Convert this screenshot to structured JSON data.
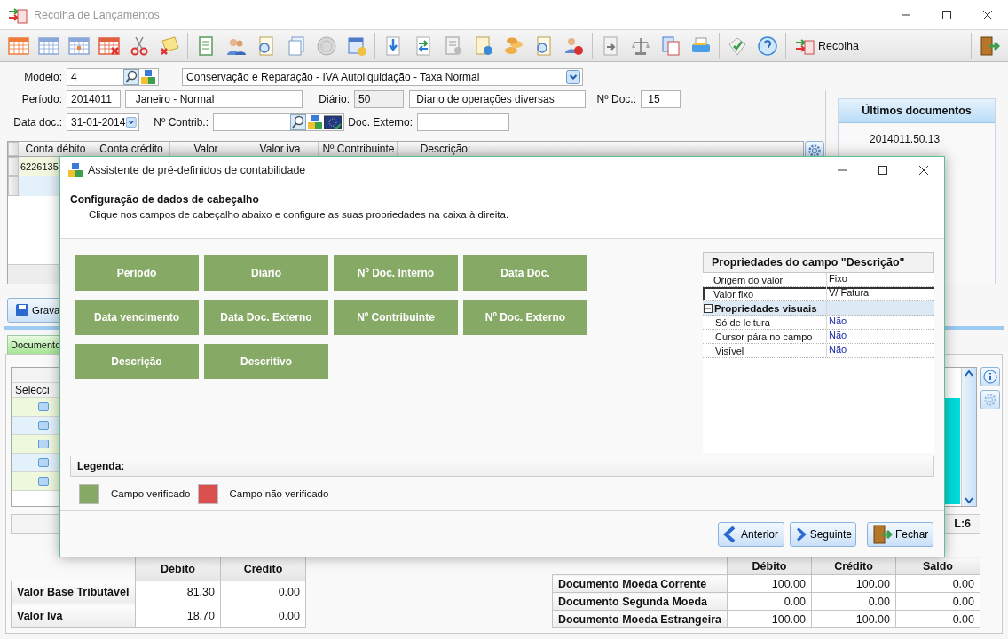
{
  "window": {
    "title": "Recolha de Lançamentos"
  },
  "toolbar": {
    "recolha_button": "Recolha"
  },
  "form": {
    "modelo": {
      "label": "Modelo:",
      "value": "4",
      "description": "Conservação e Reparação - IVA Autoliquidação - Taxa Normal"
    },
    "periodo": {
      "label": "Período:",
      "value": "2014011",
      "description": "Janeiro - Normal"
    },
    "diario": {
      "label": "Diário:",
      "value": "50",
      "description": "Diario de operações diversas"
    },
    "n_doc": {
      "label": "Nº Doc.:",
      "value": "15"
    },
    "data_doc": {
      "label": "Data doc.:",
      "value": "31-01-2014"
    },
    "n_contrib": {
      "label": "Nº Contrib.:"
    },
    "doc_externo": {
      "label": "Doc. Externo:"
    }
  },
  "entries_grid": {
    "columns": [
      "Conta débito",
      "Conta crédito",
      "Valor",
      "Valor iva",
      "Nº Contribuinte",
      "Descrição:"
    ],
    "rows": [
      [
        "6226135"
      ]
    ]
  },
  "last_documents": {
    "title": "Últimos documentos",
    "items": [
      "2014011.50.13"
    ]
  },
  "save_button": {
    "label": "Grava"
  },
  "tabs": [
    {
      "label": "Documento",
      "selected": true
    }
  ],
  "lines_grid": {
    "columns": [
      "Selecci"
    ]
  },
  "status": {
    "line_count": "L:6"
  },
  "totals": {
    "columns": [
      "Débito",
      "Crédito"
    ],
    "rows": [
      {
        "label": "Valor Base Tributável",
        "values": [
          "81.30",
          "0.00"
        ]
      },
      {
        "label": "Valor Iva",
        "values": [
          "18.70",
          "0.00"
        ]
      }
    ]
  },
  "currency_totals": {
    "columns": [
      "Débito",
      "Crédito",
      "Saldo"
    ],
    "rows": [
      {
        "label": "Documento Moeda Corrente",
        "values": [
          "100.00",
          "100.00",
          "0.00"
        ]
      },
      {
        "label": "Documento Segunda Moeda",
        "values": [
          "0.00",
          "0.00",
          "0.00"
        ]
      },
      {
        "label": "Documento Moeda Estrangeira",
        "values": [
          "100.00",
          "100.00",
          "0.00"
        ]
      }
    ]
  },
  "dialog": {
    "title": "Assistente de pré-definidos de contabilidade",
    "heading": "Configuração de dados de cabeçalho",
    "subtitle": "Clique nos campos de cabeçalho abaixo e configure as suas propriedades na caixa à direita.",
    "fields": [
      {
        "label": "Período",
        "verified": true
      },
      {
        "label": "Diário",
        "verified": true
      },
      {
        "label": "Nº Doc. Interno",
        "verified": true
      },
      {
        "label": "Data Doc.",
        "verified": true
      },
      {
        "label": "Data vencimento",
        "verified": true
      },
      {
        "label": "Data Doc. Externo",
        "verified": true
      },
      {
        "label": "Nº Contribuinte",
        "verified": true
      },
      {
        "label": "Nº Doc. Externo",
        "verified": true
      },
      {
        "label": "Descrição",
        "verified": true
      },
      {
        "label": "Descritivo",
        "verified": true
      }
    ],
    "properties": {
      "title": "Propriedades do campo \"Descrição\"",
      "rows": [
        {
          "kind": "property",
          "name": "Origem do valor",
          "value": "Fixo",
          "selected": false
        },
        {
          "kind": "property",
          "name": "Valor fixo",
          "value": "V/ Fatura",
          "selected": true
        },
        {
          "kind": "group",
          "name": "Propriedades visuais",
          "expanded": true,
          "selected": false,
          "children": [
            {
              "kind": "choice",
              "name": "Só de leitura",
              "value": "Não",
              "selected": false
            },
            {
              "kind": "choice",
              "name": "Cursor pára no campo",
              "value": "Não",
              "selected": false
            },
            {
              "kind": "choice",
              "name": "Visível",
              "value": "Não",
              "selected": false
            }
          ]
        }
      ]
    },
    "legend": {
      "title": "Legenda:",
      "items": [
        {
          "color": "#87a966",
          "label": "- Campo verificado"
        },
        {
          "color": "#d9504f",
          "label": "- Campo não verificado"
        }
      ]
    },
    "buttons": [
      {
        "kind": "back",
        "label": "Anterior"
      },
      {
        "kind": "next",
        "label": "Seguinte"
      },
      {
        "kind": "close",
        "label": "Fechar"
      }
    ]
  }
}
